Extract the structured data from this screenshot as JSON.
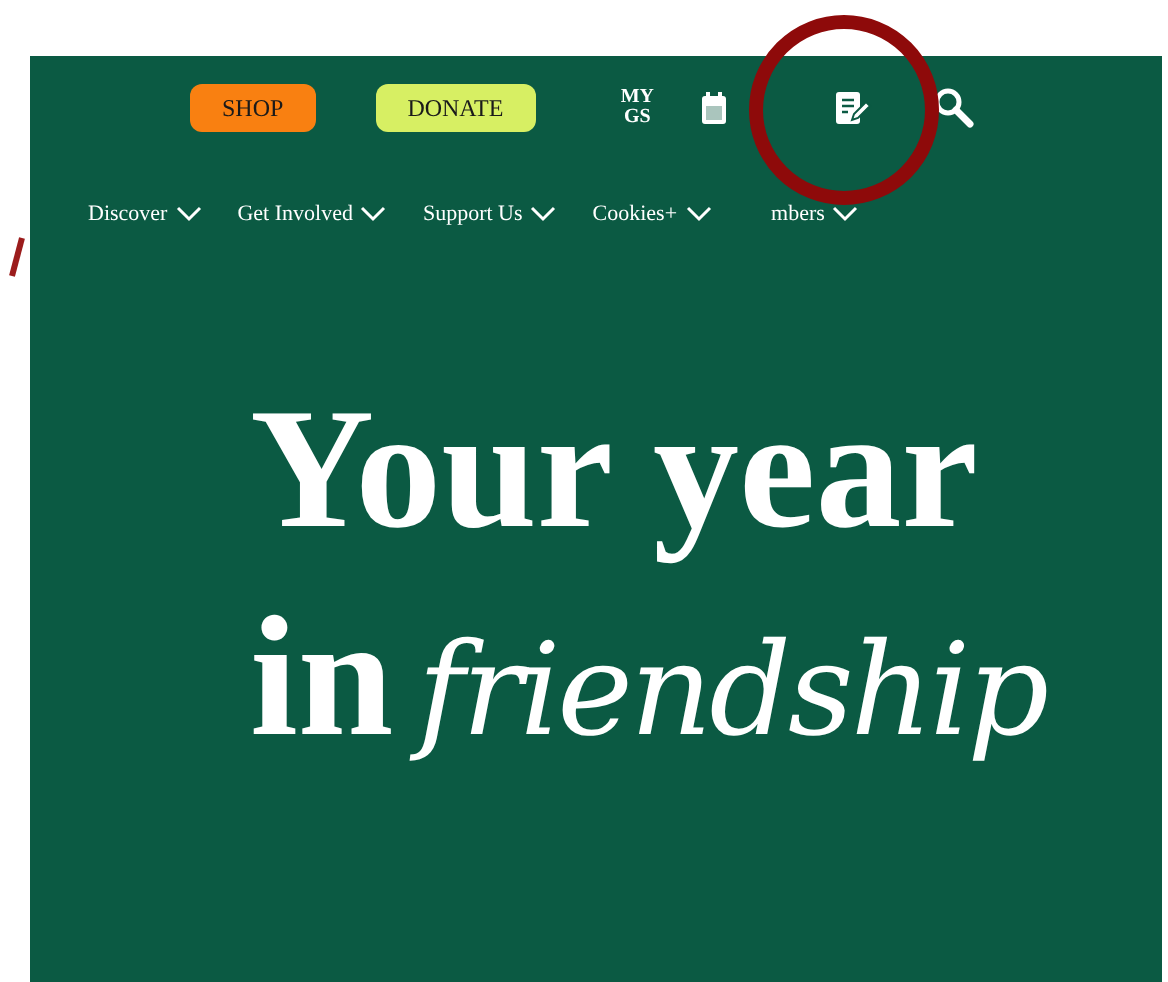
{
  "top_bar": {
    "buttons": [
      {
        "label": "SHOP",
        "color": "#f98011"
      },
      {
        "label": "DONATE",
        "color": "#d7ef63"
      }
    ],
    "my_gs": "MY GS"
  },
  "nav": [
    {
      "label": "Discover"
    },
    {
      "label": "Get Involved"
    },
    {
      "label": "Support Us"
    },
    {
      "label": "Cookies+"
    },
    {
      "label": "mbers"
    }
  ],
  "headline": {
    "line_1": "Your year",
    "line_2_plain": "in",
    "line_2_script": "friendship"
  }
}
